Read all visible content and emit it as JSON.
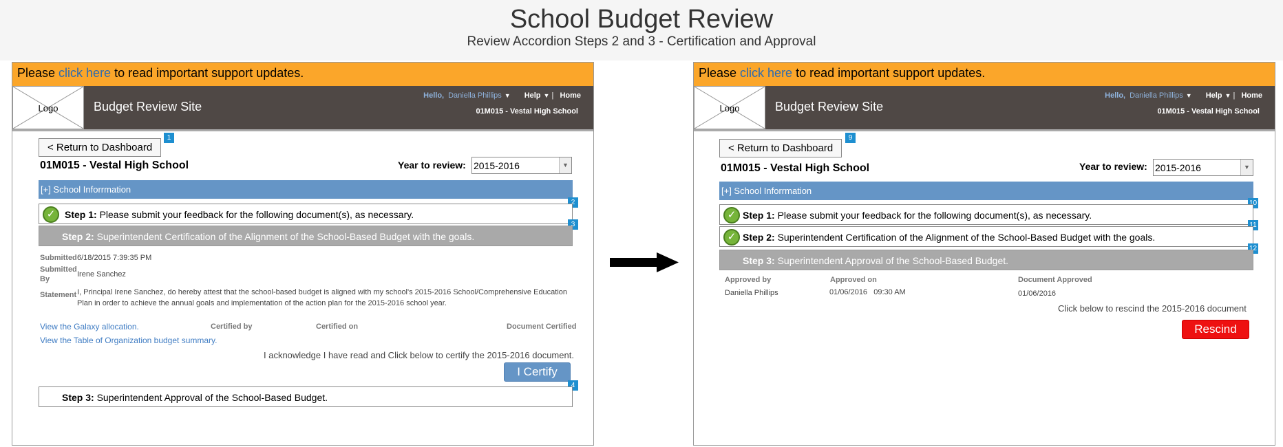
{
  "page": {
    "title": "School Budget Review",
    "subtitle": "Review Accordion Steps 2 and 3 - Certification and Approval"
  },
  "shared": {
    "support_prefix": "Please ",
    "support_link": "click here",
    "support_suffix": " to read important support updates.",
    "logo_label": "Logo",
    "site_title": "Budget Review Site",
    "hello_label": "Hello,",
    "user_name": "Daniella Phillips",
    "help_label": "Help",
    "home_label": "Home",
    "school_code": "01M015 - Vestal High School",
    "return_label": "<  Return to Dashboard",
    "school_heading": "01M015 - Vestal High School",
    "year_label": "Year to review:",
    "year_value": "2015-2016",
    "info_bar_label": "[+] School Inforrmation",
    "step1_bold": "Step 1:",
    "step1_text": " Please submit your feedback for the following document(s), as necessary.",
    "step2_bold": "Step 2:",
    "step2_text": " Superintendent Certification of the Alignment of the School-Based Budget with the goals.",
    "step3_bold": "Step 3:",
    "step3_text": " Superintendent Approval of the School-Based Budget."
  },
  "left": {
    "badges": [
      "1",
      "2",
      "3",
      "4"
    ],
    "submitted_label": "Submitted",
    "submitted_value": "6/18/2015 7:39:35 PM",
    "submitted_by_label": "Submitted By",
    "submitted_by_value": "Irene Sanchez",
    "statement_label": "Statement",
    "statement_value": "I, Principal Irene Sanchez, do hereby attest that the school-based budget is aligned with my school's 2015-2016 School/Comprehensive Education Plan in order to achieve the annual goals and implementation of the action plan for the 2015-2016 school year.",
    "link_galaxy": "View the Galaxy allocation.",
    "link_table": "View the Table of Organization budget summary.",
    "col_certified_by": "Certified by",
    "col_certified_on": "Certified on",
    "col_document_certified": "Document Certified",
    "acknowledge_text": "I acknowledge I have read and Click below to certify the 2015-2016 document.",
    "certify_label": "I Certify"
  },
  "right": {
    "badges": [
      "9",
      "10",
      "11",
      "12"
    ],
    "col_approved_by": "Approved by",
    "col_approved_on": "Approved on",
    "col_document_approved": "Document Approved",
    "approved_by": "Daniella Phillips",
    "approved_on": "01/06/2016   09:30 AM",
    "document_approved": "01/06/2016",
    "rescind_prompt": "Click below to rescind the 2015-2016 document",
    "rescind_label": "Rescind"
  },
  "colors": {
    "support_bg": "#fba62a",
    "topbar_bg": "#4f4845",
    "info_bar_bg": "#6595c6",
    "active_step_bg": "#a9a9a9",
    "badge_bg": "#1e8fd0",
    "certify_bg": "#6595c6",
    "rescind_bg": "#ee1111"
  }
}
